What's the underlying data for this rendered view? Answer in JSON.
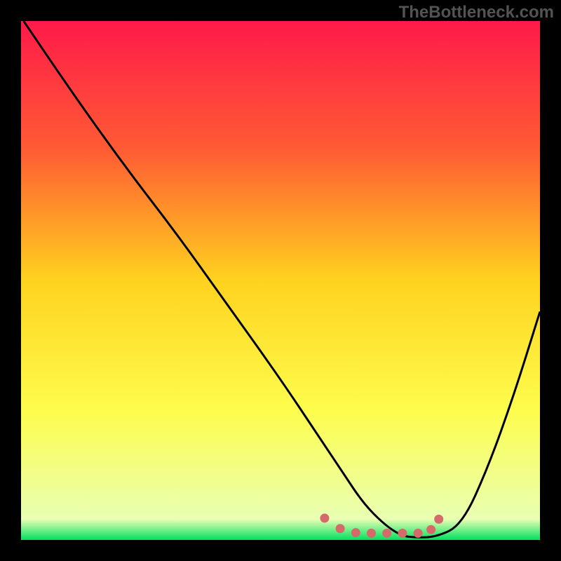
{
  "watermark": "TheBottleneck.com",
  "chart_data": {
    "type": "line",
    "title": "",
    "xlabel": "",
    "ylabel": "",
    "xlim": [
      0,
      100
    ],
    "ylim": [
      0,
      100
    ],
    "gradient_stops": [
      {
        "offset": 0,
        "color": "#ff1a4a"
      },
      {
        "offset": 25,
        "color": "#ff5c33"
      },
      {
        "offset": 50,
        "color": "#ffd21f"
      },
      {
        "offset": 75,
        "color": "#fdfd4d"
      },
      {
        "offset": 96,
        "color": "#e9ffb3"
      },
      {
        "offset": 100,
        "color": "#00e060"
      }
    ],
    "series": [
      {
        "name": "curve",
        "x": [
          0.5,
          10,
          20,
          30,
          40,
          50,
          58,
          62,
          66,
          70,
          73,
          75,
          80,
          85,
          90,
          95,
          100
        ],
        "y": [
          100,
          86,
          72,
          59,
          45,
          31,
          19,
          13,
          7,
          3,
          1,
          0.5,
          0.5,
          3,
          14,
          28,
          44
        ]
      }
    ],
    "markers": [
      {
        "x": 58.5,
        "y": 4.2
      },
      {
        "x": 61.5,
        "y": 2.2
      },
      {
        "x": 64.5,
        "y": 1.4
      },
      {
        "x": 67.5,
        "y": 1.3
      },
      {
        "x": 70.5,
        "y": 1.3
      },
      {
        "x": 73.5,
        "y": 1.3
      },
      {
        "x": 76.5,
        "y": 1.3
      },
      {
        "x": 79.0,
        "y": 2.0
      },
      {
        "x": 80.5,
        "y": 4.0
      }
    ],
    "marker_color": "#d66a6a",
    "curve_color": "#000000"
  }
}
